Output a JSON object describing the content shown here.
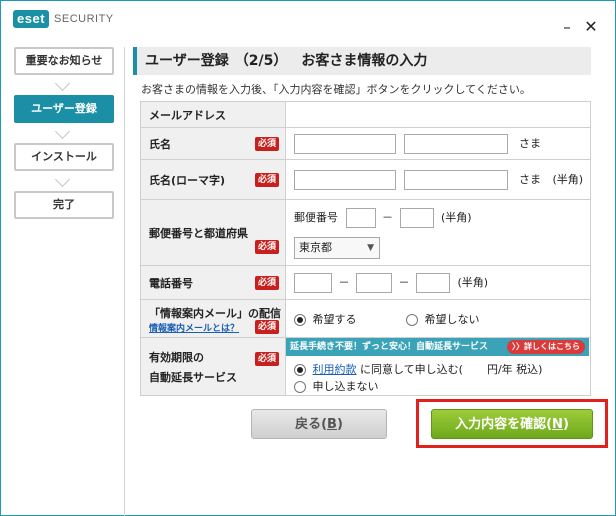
{
  "app": {
    "logo_badge": "eset",
    "logo_text": "SECURITY"
  },
  "window_controls": {
    "minimize": "–",
    "close": "✕"
  },
  "steps": [
    {
      "label": "重要なお知らせ"
    },
    {
      "label": "ユーザー登録"
    },
    {
      "label": "インストール"
    },
    {
      "label": "完了"
    }
  ],
  "page": {
    "title": "ユーザー登録",
    "step_count": "（2/5）",
    "subtitle": "お客さま情報の入力",
    "intro": "お客さまの情報を入力後、「入力内容を確認」ボタンをクリックしてください。"
  },
  "form": {
    "required_badge": "必須",
    "email": {
      "label": "メールアドレス"
    },
    "name": {
      "label": "氏名",
      "suffix": "さま"
    },
    "name_roman": {
      "label": "氏名(ローマ字)",
      "suffix": "さま",
      "note": "(半角)"
    },
    "address": {
      "label": "郵便番号と都道府県",
      "postal_label": "郵便番号",
      "dash": "－",
      "note": "(半角)",
      "prefecture": "東京都"
    },
    "phone": {
      "label": "電話番号",
      "dash1": "－",
      "dash2": "－",
      "note": "(半角)"
    },
    "newsletter": {
      "label": "「情報案内メール」の配信",
      "help_link": "情報案内メールとは？",
      "opt_yes": "希望する",
      "opt_no": "希望しない"
    },
    "auto_renew": {
      "label_line1": "有効期限の",
      "label_line2": "自動延長サービス",
      "banner": "延長手続き不要！ずっと安心！自動延長サービス",
      "banner_more": "〉〉詳しくはこちら",
      "opt_agree_link": "利用約款",
      "opt_agree_text1": "に同意して申し込む(",
      "opt_agree_text2": "円/年 税込)",
      "opt_decline": "申し込まない"
    }
  },
  "buttons": {
    "back_label": "戻る(",
    "back_key": "B",
    "confirm_label": "入力内容を確認(",
    "confirm_key": "N",
    "close_paren": ")"
  },
  "colors": {
    "accent": "#1a8fa6",
    "required": "#c8201e",
    "confirm": "#7cb526",
    "highlight": "#e3211c"
  }
}
